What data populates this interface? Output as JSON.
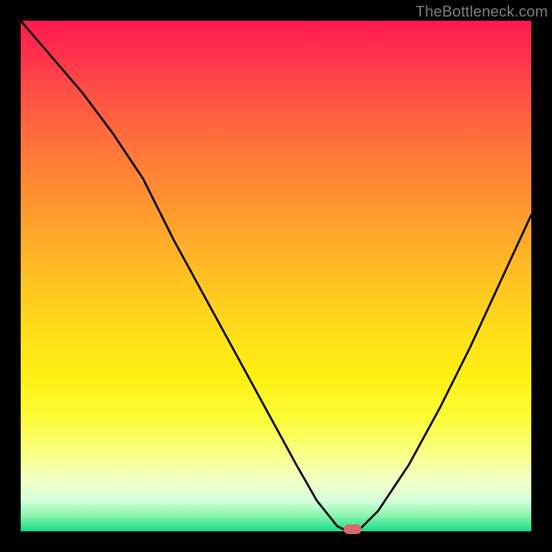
{
  "watermark": "TheBottleneck.com",
  "colors": {
    "curve": "#000000",
    "marker": "#d96a6c",
    "background_frame": "#000000"
  },
  "chart_data": {
    "type": "line",
    "title": "",
    "xlabel": "",
    "ylabel": "",
    "xlim": [
      0,
      100
    ],
    "ylim": [
      0,
      100
    ],
    "grid": false,
    "series": [
      {
        "name": "bottleneck-curve",
        "x": [
          0,
          6,
          12,
          18,
          24,
          30,
          36,
          42,
          48,
          54,
          58,
          62,
          64,
          66,
          70,
          76,
          82,
          88,
          94,
          100
        ],
        "values": [
          100,
          93,
          86,
          78,
          69,
          57,
          46,
          35,
          24,
          13,
          6,
          1,
          0,
          0,
          4,
          13,
          24,
          36,
          49,
          62
        ]
      }
    ],
    "marker": {
      "x": 65,
      "y": 0
    },
    "gradient_stops": [
      {
        "pos": 0,
        "color": "#ff1a4f"
      },
      {
        "pos": 50,
        "color": "#ffd21a"
      },
      {
        "pos": 85,
        "color": "#fdff70"
      },
      {
        "pos": 100,
        "color": "#13dc89"
      }
    ]
  }
}
